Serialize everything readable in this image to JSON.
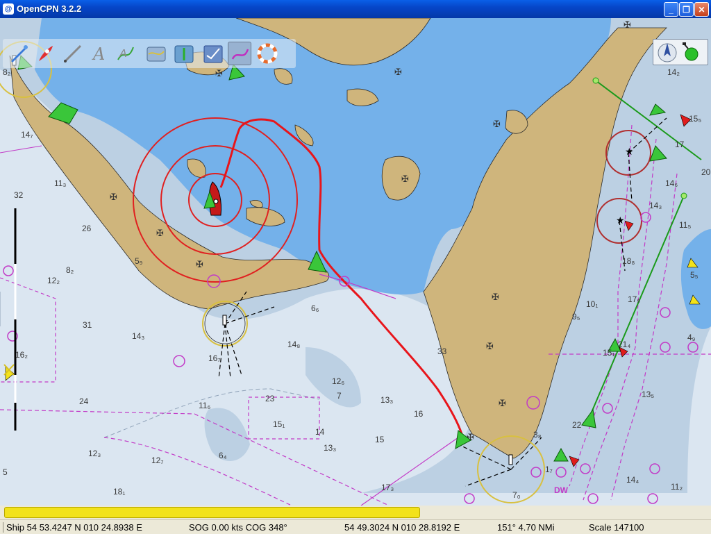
{
  "window": {
    "title": "OpenCPN 3.2.2",
    "app_icon_glyph": "@",
    "minimize": "_",
    "maximize": "❐",
    "close": "✕"
  },
  "toolbar": {
    "tools": [
      {
        "name": "zoom-in-tool-icon"
      },
      {
        "name": "route-rocket-icon"
      },
      {
        "name": "measure-tool-icon"
      },
      {
        "name": "text-tool-icon"
      },
      {
        "name": "route-tool-icon"
      },
      {
        "name": "chart-tool-icon"
      },
      {
        "name": "tide-tool-icon"
      },
      {
        "name": "ais-tool-icon"
      },
      {
        "name": "track-tool-icon"
      },
      {
        "name": "man-overboard-icon"
      }
    ],
    "selected_tool": "track-tool-icon"
  },
  "chart": {
    "depth_labels": [
      "14₂",
      "15₅",
      "17",
      "14₆",
      "14₃",
      "11₅",
      "10₁",
      "9₅",
      "18₈",
      "17₉",
      "20",
      "5₅",
      "15₁",
      "13₅",
      "4₉",
      "22",
      "21₄",
      "14₄",
      "11₂",
      "7₀",
      "3₈",
      "33",
      "1₇",
      "32",
      "26",
      "8₂",
      "12₂",
      "5₉",
      "31",
      "14₃",
      "14₈",
      "16₇",
      "12₆",
      "7",
      "13₃",
      "16",
      "24",
      "23",
      "15₁",
      "14",
      "11₆",
      "12₃",
      "12₇",
      "6₄",
      "13₃",
      "15",
      "18₁",
      "17₃",
      "5",
      "16₂",
      "8₂",
      "14₇",
      "11₃",
      "6₆",
      "DW"
    ],
    "colors": {
      "deep": "#dbe6f1",
      "medium": "#bcd0e3",
      "shallow": "#74b1ea",
      "land": "#cfb57c",
      "track": "#e8151b",
      "range_ring": "#e02020"
    }
  },
  "compass": {
    "north_icon": "north-arrow-icon",
    "gps_status": "gps-ok-icon"
  },
  "progress": {
    "percent": 59,
    "color": "#f2e21b"
  },
  "status": {
    "ship": "Ship 54 53.4247 N   010 24.8938 E",
    "sog": "SOG 0.00 kts  COG 348°",
    "cursor": "54 49.3024 N   010 28.8192 E",
    "bearing": "151°  4.70 NMi",
    "scale": "Scale 147100"
  }
}
